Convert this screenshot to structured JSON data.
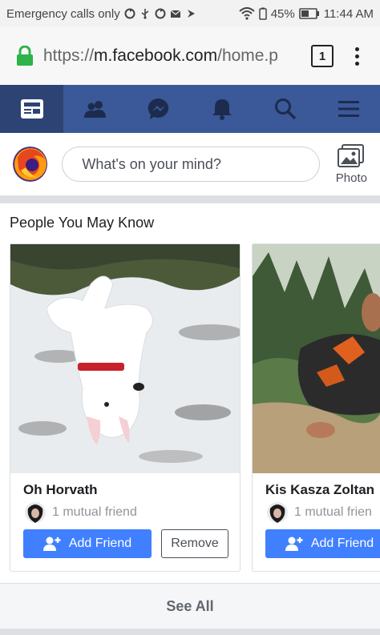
{
  "status_bar": {
    "left_text": "Emergency calls only",
    "battery": "45%",
    "time": "11:44 AM",
    "icons": [
      "sync-icon",
      "usb-icon",
      "sync-icon",
      "mail-icon",
      "play-icon",
      "wifi-icon",
      "battery-saver-icon",
      "battery-icon"
    ]
  },
  "browser": {
    "url_prefix": "https://",
    "url_host": "m.facebook.com",
    "url_path": "/home.p",
    "tab_count": "1",
    "lock_color": "#2db34a"
  },
  "nav": {
    "items": [
      "news-feed-icon",
      "friends-icon",
      "messenger-icon",
      "notifications-icon",
      "search-icon",
      "menu-icon"
    ],
    "bg_color": "#3b5998",
    "active_color": "#2d4373"
  },
  "composer": {
    "placeholder": "What's on your mind?",
    "photo_label": "Photo"
  },
  "pymk": {
    "title": "People You May Know",
    "cards": [
      {
        "name": "Oh Horvath",
        "mutual": "1 mutual friend",
        "add_label": "Add Friend",
        "remove_label": "Remove"
      },
      {
        "name": "Kis Kasza Zoltan",
        "mutual": "1 mutual frien",
        "add_label": "Add Friend"
      }
    ],
    "see_all": "See All"
  },
  "colors": {
    "add_button": "#4080ff",
    "fb_blue": "#3b5998"
  }
}
